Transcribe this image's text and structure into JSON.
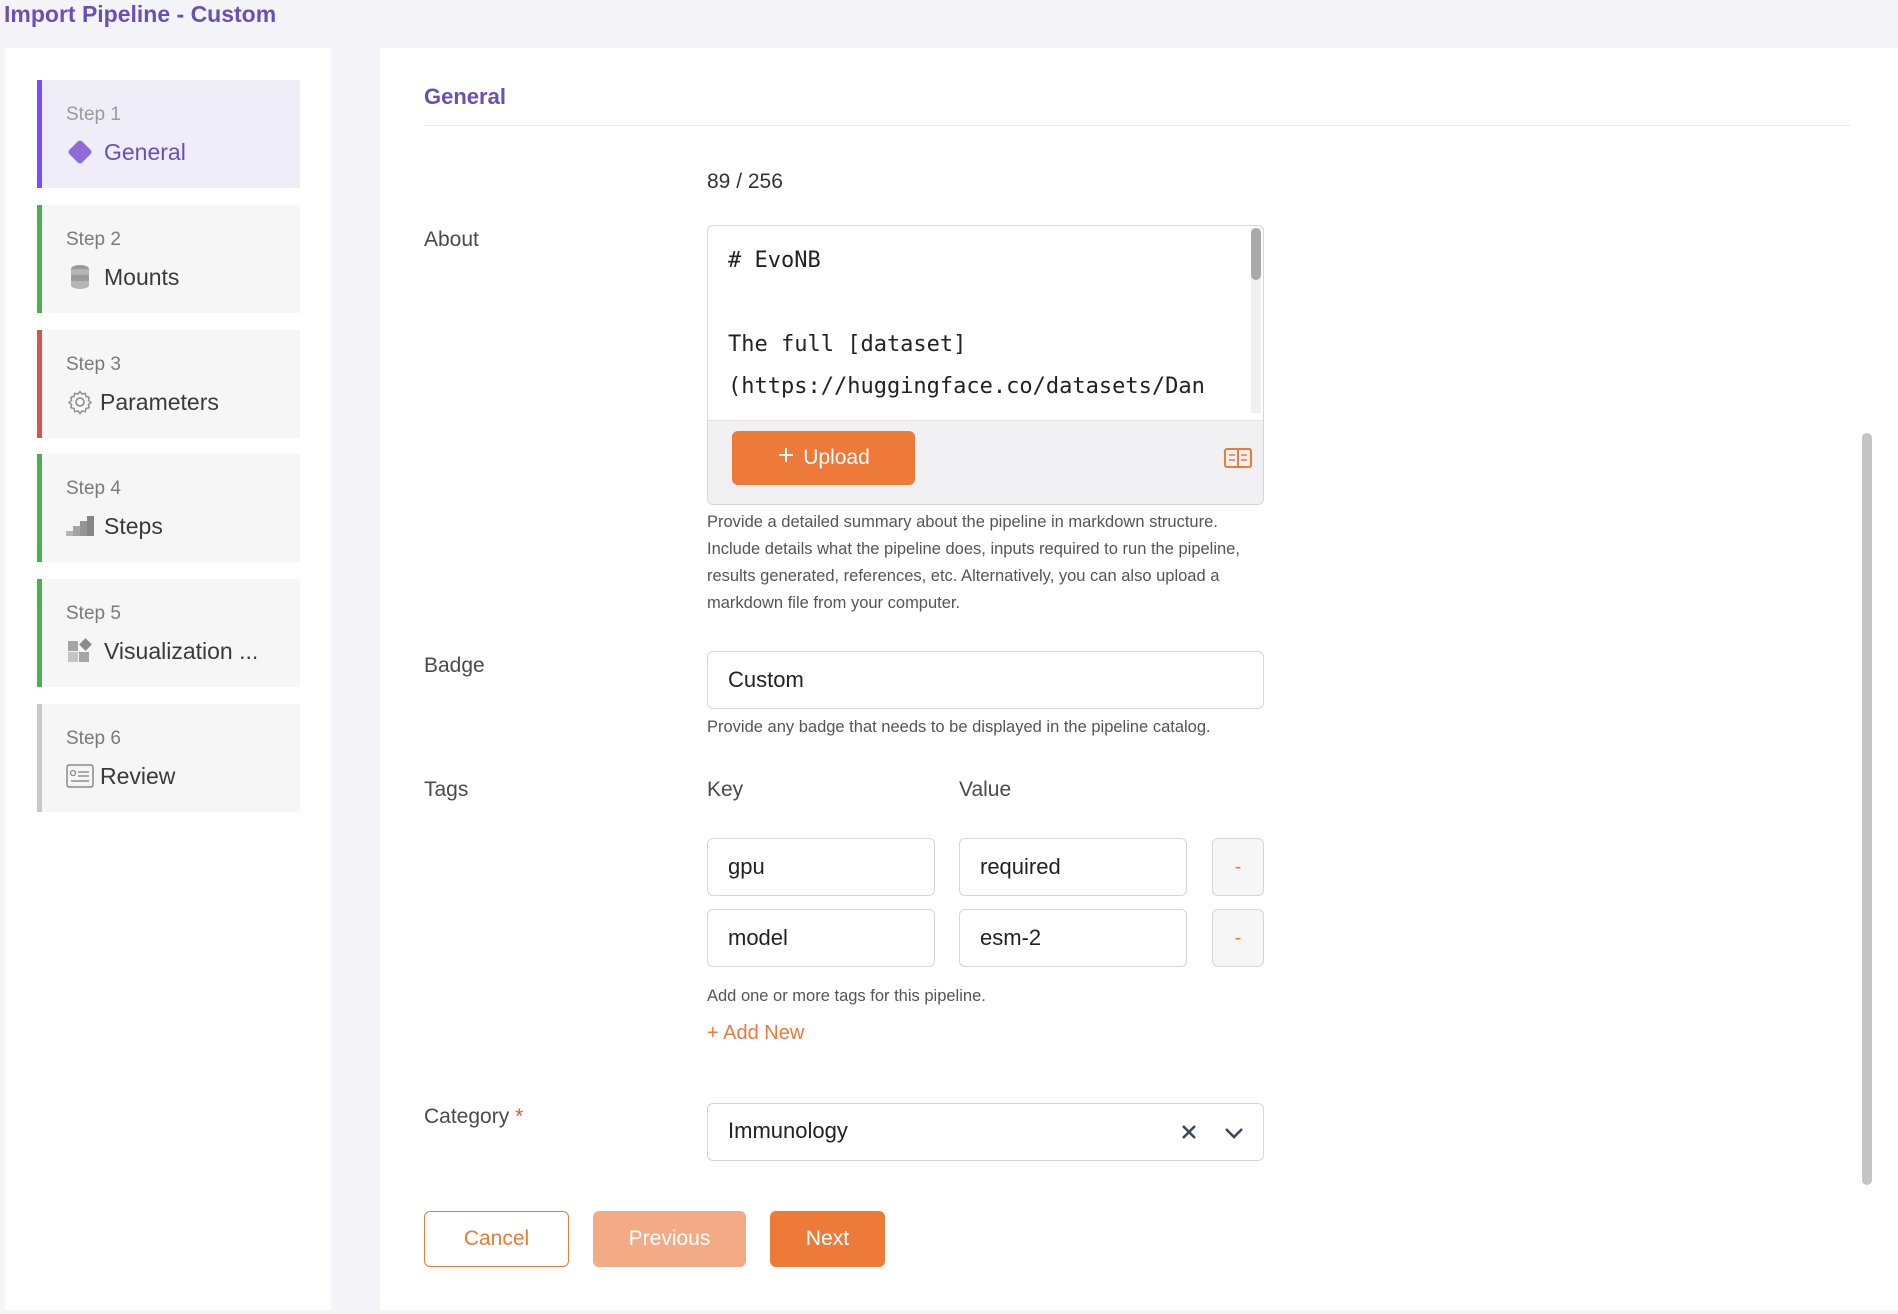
{
  "page_title": "Import Pipeline - Custom",
  "sidebar": {
    "steps": [
      {
        "num": "Step 1",
        "label": "General",
        "icon": "diamond-icon"
      },
      {
        "num": "Step 2",
        "label": "Mounts",
        "icon": "database-icon"
      },
      {
        "num": "Step 3",
        "label": "Parameters",
        "icon": "gear-icon"
      },
      {
        "num": "Step 4",
        "label": "Steps",
        "icon": "stairs-icon"
      },
      {
        "num": "Step 5",
        "label": "Visualization ...",
        "icon": "widgets-icon"
      },
      {
        "num": "Step 6",
        "label": "Review",
        "icon": "review-list-icon"
      }
    ]
  },
  "main": {
    "section_title": "General",
    "about": {
      "label": "About",
      "counter": "89 / 256",
      "text": "# EvoNB\n\nThe full [dataset]\n(https://huggingface.co/datasets/Dan",
      "upload_label": "Upload",
      "help": "Provide a detailed summary about the pipeline in markdown structure. Include details what the pipeline does, inputs required to run the pipeline, results generated, references, etc. Alternatively, you can also upload a markdown file from your computer."
    },
    "badge": {
      "label": "Badge",
      "value": "Custom",
      "help": "Provide any badge that needs to be displayed in the pipeline catalog."
    },
    "tags": {
      "label": "Tags",
      "key_header": "Key",
      "value_header": "Value",
      "rows": [
        {
          "key": "gpu",
          "value": "required",
          "remove": "-"
        },
        {
          "key": "model",
          "value": "esm-2",
          "remove": "-"
        }
      ],
      "help": "Add one or more tags for this pipeline.",
      "add_new": "+ Add New"
    },
    "category": {
      "label": "Category",
      "required_mark": "*",
      "value": "Immunology"
    },
    "buttons": {
      "cancel": "Cancel",
      "previous": "Previous",
      "next": "Next"
    }
  },
  "colors": {
    "accent_purple": "#6b4fb8",
    "accent_orange": "#ee7a3a",
    "step_done_green": "#4caf50",
    "step_error_red": "#d9534f"
  }
}
